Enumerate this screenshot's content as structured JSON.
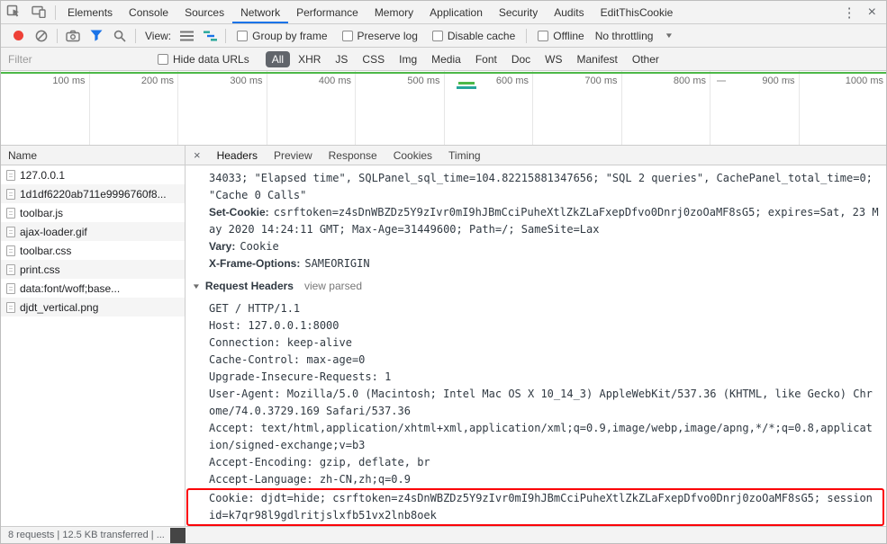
{
  "colors": {
    "accent_blue": "#1a73e8",
    "record_red": "#ee4037",
    "overview_green": "#4db848",
    "highlight_red": "#fb0007",
    "active_pill_bg": "#61656b"
  },
  "icons": {
    "close": "×",
    "overflow": "⋮",
    "dropdown": "▼",
    "disclosure": "▼"
  },
  "devtools": {
    "tabs": [
      "Elements",
      "Console",
      "Sources",
      "Network",
      "Performance",
      "Memory",
      "Application",
      "Security",
      "Audits",
      "EditThisCookie"
    ],
    "active_tab": "Network"
  },
  "toolbar": {
    "view_label": "View:",
    "group_by_frame": "Group by frame",
    "preserve_log": "Preserve log",
    "disable_cache": "Disable cache",
    "offline": "Offline",
    "throttling": "No throttling"
  },
  "filter": {
    "placeholder": "Filter",
    "hide_data_urls": "Hide data URLs",
    "types": [
      "All",
      "XHR",
      "JS",
      "CSS",
      "Img",
      "Media",
      "Font",
      "Doc",
      "WS",
      "Manifest",
      "Other"
    ],
    "active_type": "All"
  },
  "timeline": {
    "ticks": [
      "100 ms",
      "200 ms",
      "300 ms",
      "400 ms",
      "500 ms",
      "600 ms",
      "700 ms",
      "800 ms",
      "900 ms",
      "1000 ms"
    ]
  },
  "requests": {
    "header": "Name",
    "rows": [
      {
        "name": "127.0.0.1",
        "icon": "document-icon"
      },
      {
        "name": "1d1df6220ab711e9996760f8...",
        "icon": "image-icon"
      },
      {
        "name": "toolbar.js",
        "icon": "script-icon"
      },
      {
        "name": "ajax-loader.gif",
        "icon": "image-icon"
      },
      {
        "name": "toolbar.css",
        "icon": "stylesheet-icon"
      },
      {
        "name": "print.css",
        "icon": "stylesheet-icon"
      },
      {
        "name": "data:font/woff;base...",
        "icon": "font-icon"
      },
      {
        "name": "djdt_vertical.png",
        "icon": "image-icon"
      }
    ]
  },
  "detail": {
    "tabs": [
      "Headers",
      "Preview",
      "Response",
      "Cookies",
      "Timing"
    ],
    "active_tab": "Headers",
    "response_tail": "34033; \"Elapsed time\", SQLPanel_sql_time=104.82215881347656; \"SQL 2 queries\", CachePanel_total_time=0; \"Cache 0 Calls\"",
    "headers": [
      {
        "name": "Set-Cookie:",
        "value": "csrftoken=z4sDnWBZDz5Y9zIvr0mI9hJBmCciPuheXtlZkZLaFxepDfvo0Dnrj0zoOaMF8sG5; expires=Sat, 23 May 2020 14:24:11 GMT; Max-Age=31449600; Path=/; SameSite=Lax"
      },
      {
        "name": "Vary:",
        "value": "Cookie"
      },
      {
        "name": "X-Frame-Options:",
        "value": "SAMEORIGIN"
      }
    ],
    "request_headers_section": {
      "label": "Request Headers",
      "link": "view parsed"
    },
    "raw": [
      "GET / HTTP/1.1",
      "Host: 127.0.0.1:8000",
      "Connection: keep-alive",
      "Cache-Control: max-age=0",
      "Upgrade-Insecure-Requests: 1",
      "User-Agent: Mozilla/5.0 (Macintosh; Intel Mac OS X 10_14_3) AppleWebKit/537.36 (KHTML, like Gecko) Chrome/74.0.3729.169 Safari/537.36",
      "Accept: text/html,application/xhtml+xml,application/xml;q=0.9,image/webp,image/apng,*/*;q=0.8,application/signed-exchange;v=b3",
      "Accept-Encoding: gzip, deflate, br",
      "Accept-Language: zh-CN,zh;q=0.9",
      "Cookie: djdt=hide; csrftoken=z4sDnWBZDz5Y9zIvr0mI9hJBmCciPuheXtlZkZLaFxepDfvo0Dnrj0zoOaMF8sG5; sessionid=k7qr98l9gdlritjslxfb51vx2lnb8oek"
    ]
  },
  "status": {
    "text": "8 requests | 12.5 KB transferred | ..."
  }
}
